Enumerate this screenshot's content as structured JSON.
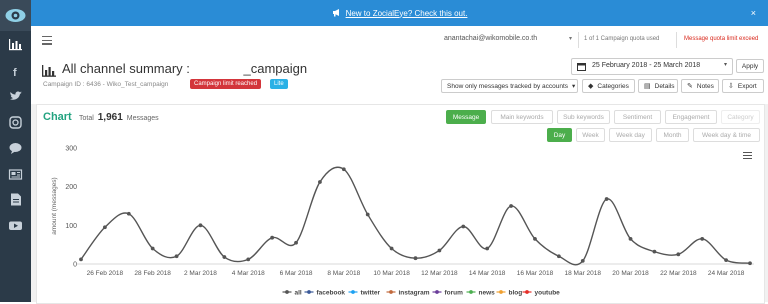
{
  "announcement": {
    "text": "New to ZocialEye? Check this out.",
    "close": "×"
  },
  "header": {
    "user_email": "anantachai@wikomobile.co.th",
    "quota_text": "1 of 1 Campaign quota used",
    "quota_exceed_text": "Message quota limit exceed"
  },
  "title": {
    "prefix": "All channel summary :",
    "suffix": "_campaign",
    "campaign_id": "Campaign ID : 6436 - Wiko_Test_campaign",
    "limit_badge": "Campaign limit reached",
    "lite_badge": "Lite"
  },
  "toolbar": {
    "date_range": "25 February 2018 - 25 March 2018",
    "apply": "Apply",
    "filter": "Show only messages tracked by accounts",
    "categories": "Categories",
    "details": "Details",
    "notes": "Notes",
    "export": "Export"
  },
  "chart_panel": {
    "label": "Chart",
    "total_label": "Total",
    "total_value": "1,961",
    "total_unit": "Messages",
    "metric_tabs": [
      "Message",
      "Main keywords",
      "Sub keywords",
      "Sentiment",
      "Engagement",
      "Category"
    ],
    "period_tabs": [
      "Day",
      "Week",
      "Week day",
      "Month",
      "Week day & time"
    ]
  },
  "chart_data": {
    "type": "line",
    "title": "",
    "xlabel": "",
    "ylabel": "amount (messages)",
    "ylim": [
      0,
      300
    ],
    "yticks": [
      0,
      100,
      200,
      300
    ],
    "x": [
      "25 Feb 2018",
      "26 Feb 2018",
      "27 Feb 2018",
      "28 Feb 2018",
      "1 Mar 2018",
      "2 Mar 2018",
      "3 Mar 2018",
      "4 Mar 2018",
      "5 Mar 2018",
      "6 Mar 2018",
      "7 Mar 2018",
      "8 Mar 2018",
      "9 Mar 2018",
      "10 Mar 2018",
      "11 Mar 2018",
      "12 Mar 2018",
      "13 Mar 2018",
      "14 Mar 2018",
      "15 Mar 2018",
      "16 Mar 2018",
      "17 Mar 2018",
      "18 Mar 2018",
      "19 Mar 2018",
      "20 Mar 2018",
      "21 Mar 2018",
      "22 Mar 2018",
      "23 Mar 2018",
      "24 Mar 2018",
      "25 Mar 2018"
    ],
    "xtick_labels": [
      "26 Feb 2018",
      "28 Feb 2018",
      "2 Mar 2018",
      "4 Mar 2018",
      "6 Mar 2018",
      "8 Mar 2018",
      "10 Mar 2018",
      "12 Mar 2018",
      "14 Mar 2018",
      "16 Mar 2018",
      "18 Mar 2018",
      "20 Mar 2018",
      "22 Mar 2018",
      "24 Mar 2018"
    ],
    "series": [
      {
        "name": "all",
        "color": "#555555",
        "values": [
          12,
          95,
          130,
          40,
          20,
          100,
          18,
          12,
          68,
          55,
          212,
          245,
          128,
          40,
          15,
          35,
          97,
          40,
          150,
          65,
          20,
          8,
          168,
          65,
          32,
          25,
          65,
          10,
          2
        ]
      }
    ],
    "legend": [
      {
        "name": "all",
        "color": "#555555"
      },
      {
        "name": "facebook",
        "color": "#3b5998"
      },
      {
        "name": "twitter",
        "color": "#1da1f2"
      },
      {
        "name": "instagram",
        "color": "#c1693c"
      },
      {
        "name": "forum",
        "color": "#6a3d9a"
      },
      {
        "name": "news",
        "color": "#4caf50"
      },
      {
        "name": "blog",
        "color": "#f0a030"
      },
      {
        "name": "youtube",
        "color": "#e52d27"
      }
    ],
    "legend_position": "bottom-center",
    "grid": false
  }
}
